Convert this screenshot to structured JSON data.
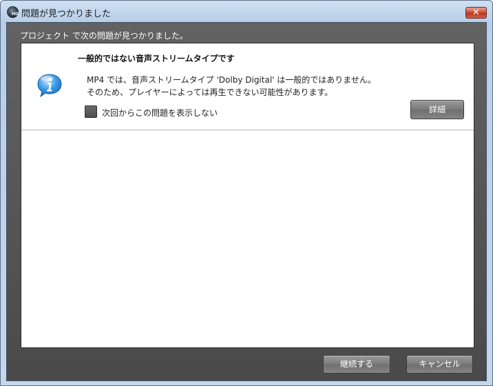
{
  "window": {
    "title": "問題が見つかりました",
    "close_label": "✕"
  },
  "header": {
    "text": "プロジェクト で次の問題が見つかりました。"
  },
  "issue": {
    "title": "一般的ではない音声ストリームタイプです",
    "icon": "info-icon",
    "message_line1": "MP4 では、音声ストリームタイプ 'Dolby Digital' は一般的ではありません。",
    "message_line2": "そのため、プレイヤーによっては再生できない可能性があります。",
    "checkbox_label": "次回からこの問題を表示しない",
    "checkbox_checked": false,
    "details_label": "詳細"
  },
  "footer": {
    "continue_label": "継続する",
    "cancel_label": "キャンセル"
  },
  "colors": {
    "title_bar": "#c4d7ec",
    "client_bg": "#555555",
    "panel_bg": "#ffffff",
    "button_bg": "#7a7a7a",
    "close_button": "#cf4b36",
    "info_icon": "#2f8fdc"
  }
}
